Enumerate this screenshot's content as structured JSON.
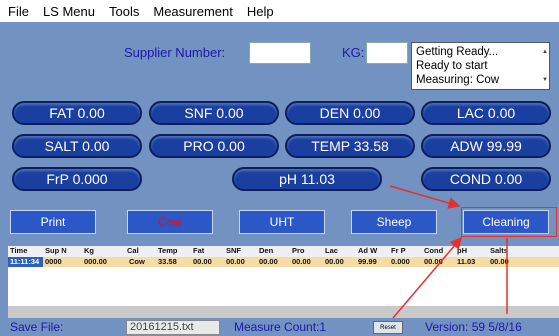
{
  "menu": [
    "File",
    "LS Menu",
    "Tools",
    "Measurement",
    "Help"
  ],
  "supplier": {
    "label": "Supplier Number:",
    "value": ""
  },
  "kg": {
    "label": "KG:",
    "value": ""
  },
  "status": [
    "Getting Ready...",
    "Ready to start",
    "Measuring: Cow"
  ],
  "readings": {
    "fat": "FAT 0.00",
    "snf": "SNF 0.00",
    "den": "DEN 0.00",
    "lac": "LAC 0.00",
    "salt": "SALT 0.00",
    "pro": "PRO 0.00",
    "temp": "TEMP 33.58",
    "adw": "ADW 99.99",
    "frp": "FrP 0.000",
    "ph": "pH 11.03",
    "cond": "COND 0.00"
  },
  "modes": {
    "print": "Print",
    "cow": "Cow",
    "uht": "UHT",
    "sheep": "Sheep",
    "cleaning": "Cleaning"
  },
  "table": {
    "columns": [
      "Time",
      "Sup N",
      "Kg",
      "Cal",
      "Temp",
      "Fat",
      "SNF",
      "Den",
      "Pro",
      "Lac",
      "Ad W",
      "Fr P",
      "Cond",
      "pH",
      "Salts"
    ],
    "rows": [
      [
        "11:11:34",
        "0000",
        "000.00",
        "Cow",
        "33.58",
        "00.00",
        "00.00",
        "00.00",
        "00.00",
        "00.00",
        "99.99",
        "0.000",
        "00.00",
        "11.03",
        "00.00"
      ]
    ]
  },
  "footer": {
    "save_label": "Save File:",
    "file_name": "20161215.txt",
    "measure_count": "Measure Count:1",
    "reset": "Reset",
    "version": "Version: 59  5/8/16"
  },
  "colors": {
    "background": "#7293c2",
    "pill": "#1b3fa0",
    "label": "#1a1aa8",
    "arrow": "#e53030",
    "row_highlight": "#f5dca4"
  }
}
